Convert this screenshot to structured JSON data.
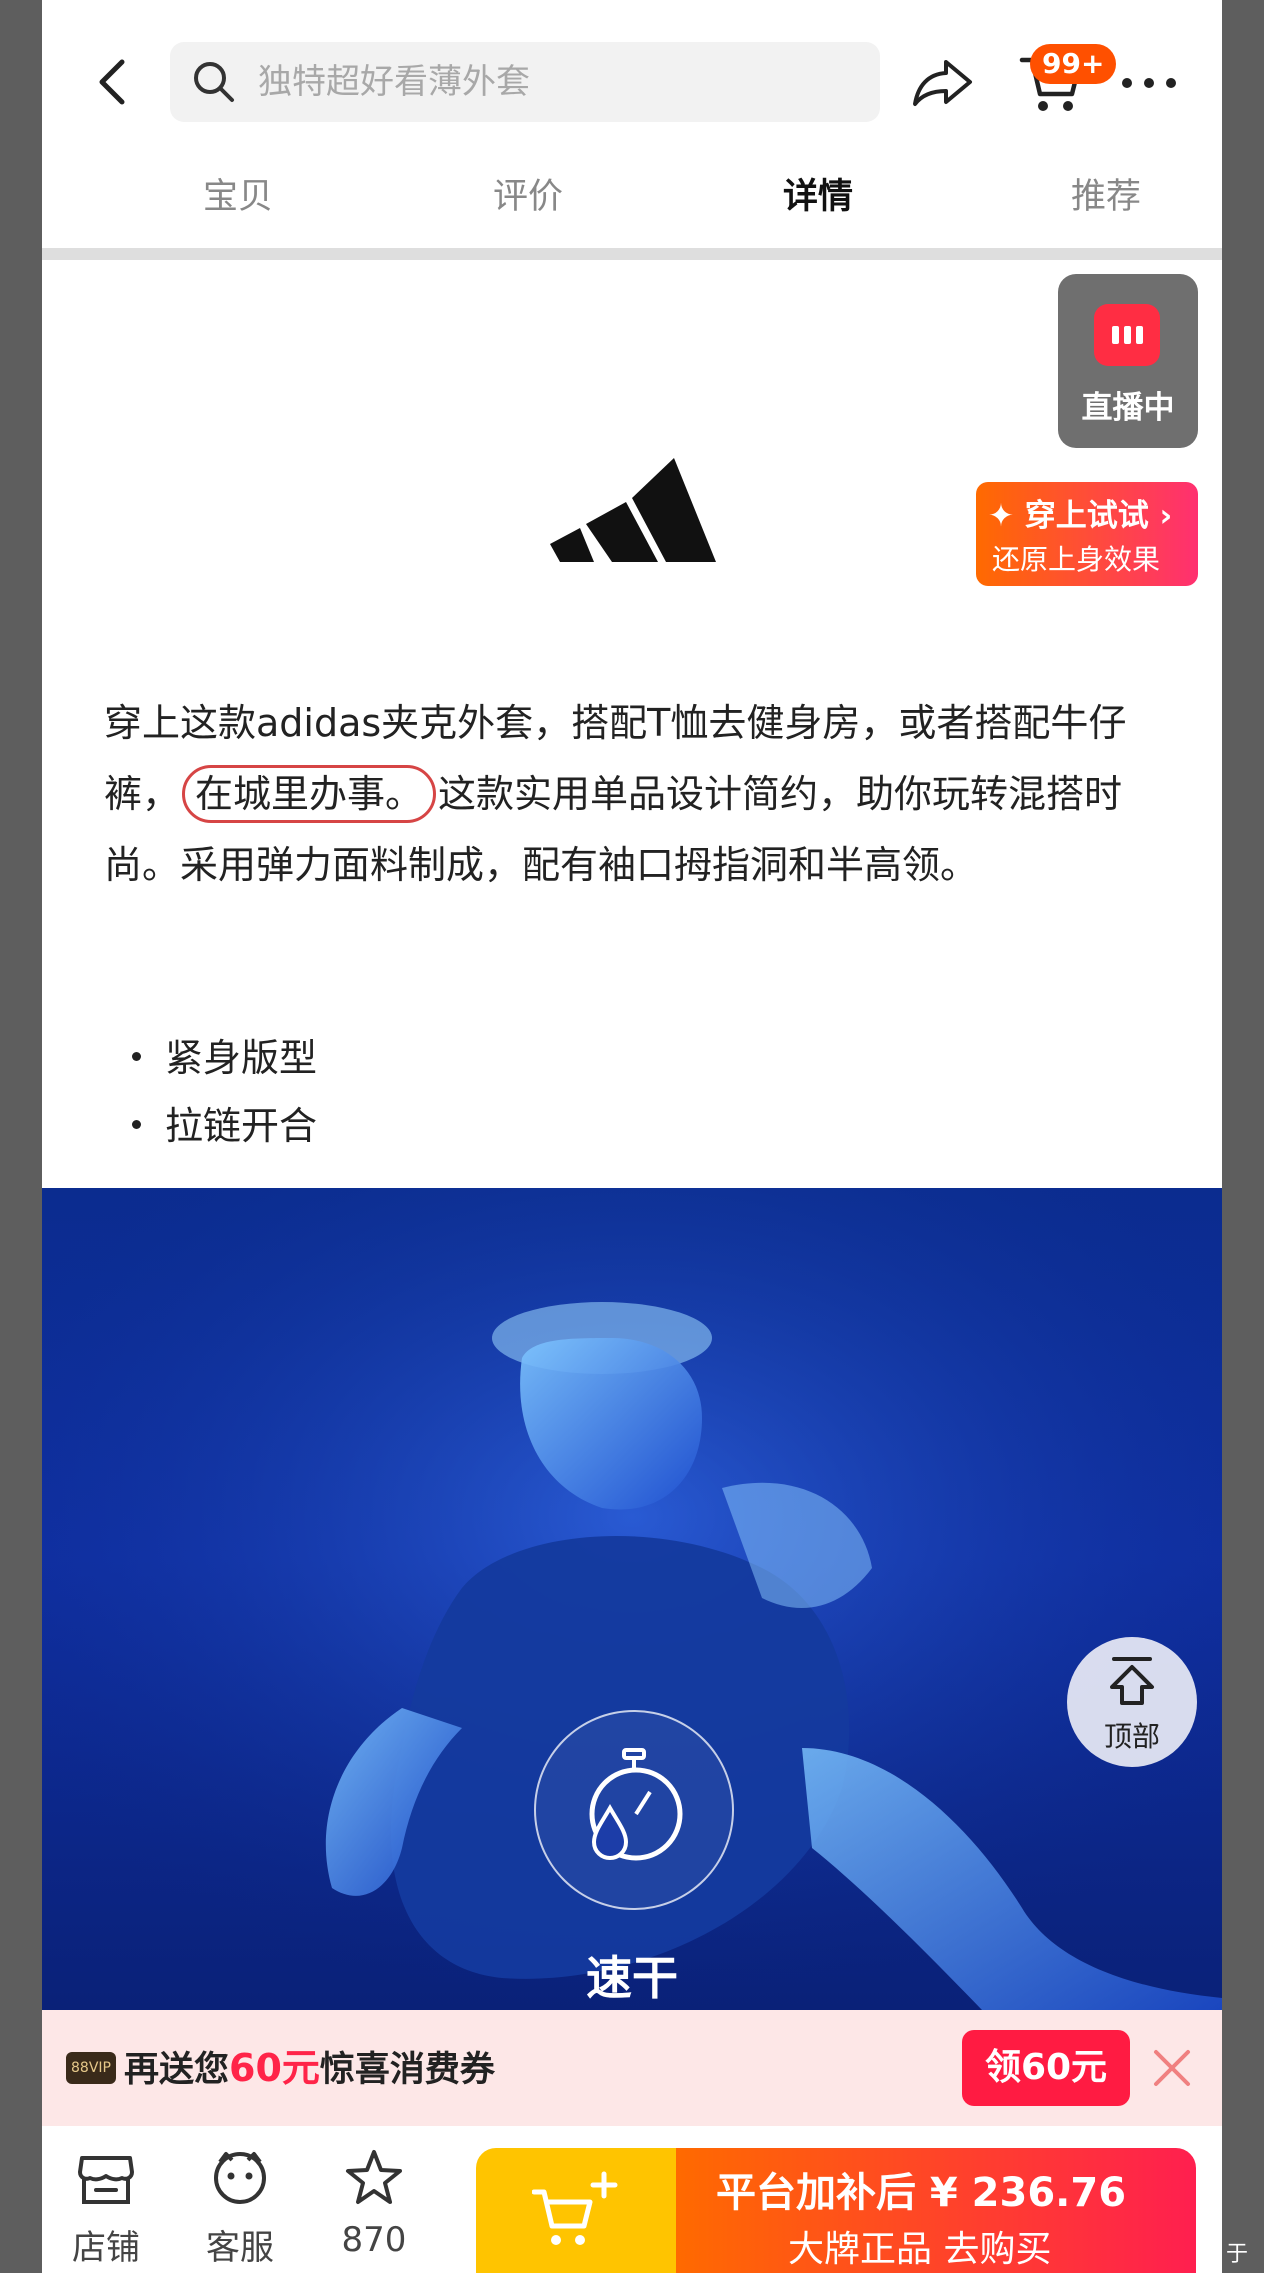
{
  "search": {
    "placeholder": "独特超好看薄外套"
  },
  "cart": {
    "badge": "99+"
  },
  "tabs": [
    {
      "label": "宝贝",
      "active": false
    },
    {
      "label": "评价",
      "active": false
    },
    {
      "label": "详情",
      "active": true
    },
    {
      "label": "推荐",
      "active": false
    }
  ],
  "live": {
    "label": "直播中"
  },
  "tryon": {
    "title": "✦ 穿上试试 ›",
    "subtitle": "还原上身效果"
  },
  "description": {
    "part1": "穿上这款adidas夹克外套，搭配T恤去健身房，或者搭配牛仔裤，",
    "circled": "在城里办事。",
    "part2": "这款实用单品设计简约，助你玩转混搭时尚。采用弹力面料制成，配有袖口拇指洞和半高领。"
  },
  "bullets": [
    "紧身版型",
    "拉链开合"
  ],
  "hero": {
    "feature_label": "速干"
  },
  "to_top": {
    "label": "顶部"
  },
  "coupon": {
    "vip": "88VIP",
    "prefix": "再送您",
    "amount": "60元",
    "suffix": "惊喜消费券",
    "button": "领60元"
  },
  "bottom_nav": [
    {
      "label": "店铺",
      "icon": "store-icon"
    },
    {
      "label": "客服",
      "icon": "customer-service-icon"
    },
    {
      "label": "870",
      "icon": "star-icon"
    }
  ],
  "buy": {
    "line1": "平台加补后 ¥ 236.76",
    "line2": "大牌正品  去购买"
  },
  "edge_text": "于",
  "colors": {
    "accent_orange": "#ff5000",
    "coupon_red": "#ff1b42",
    "add_cart_yellow": "#ffc400",
    "hero_blue": "#0f2ea0"
  }
}
